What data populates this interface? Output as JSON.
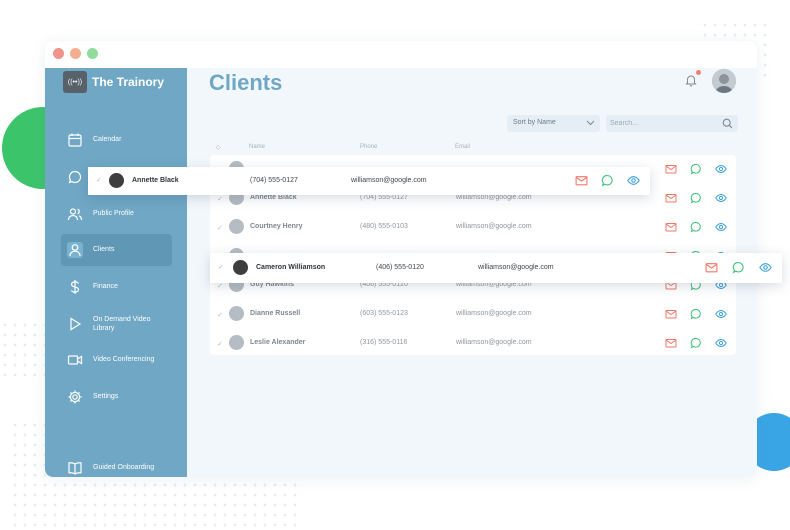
{
  "window": {
    "traffic_lights": [
      "#f0938a",
      "#f5ad92",
      "#8fdc9c"
    ]
  },
  "brand": {
    "logo_text": "((••))",
    "name": "The Trainory"
  },
  "sidebar": {
    "items": [
      {
        "label": "Calendar",
        "icon": "calendar-icon"
      },
      {
        "label": "",
        "icon": "chat-bubble-icon"
      },
      {
        "label": "Public Profile",
        "icon": "users-icon"
      },
      {
        "label": "Clients",
        "icon": "user-icon",
        "active": true
      },
      {
        "label": "Finance",
        "icon": "dollar-icon"
      },
      {
        "label": "On Demand Video Library",
        "icon": "play-icon"
      },
      {
        "label": "Video Conferencing",
        "icon": "video-camera-icon"
      },
      {
        "label": "Settings",
        "icon": "gear-icon"
      },
      {
        "label": "Guided Onboarding",
        "icon": "book-icon"
      }
    ]
  },
  "header": {
    "title": "Clients"
  },
  "toolbar": {
    "sort_label": "Sort by Name",
    "search_placeholder": "Search..."
  },
  "table": {
    "columns": {
      "name": "Name",
      "phone": "Phone",
      "email": "Email"
    },
    "rows": [
      {
        "name": "",
        "phone": "",
        "email": "",
        "partial": true
      },
      {
        "name": "Annette Black",
        "phone": "(704) 555-0127",
        "email": "williamson@google.com"
      },
      {
        "name": "Courtney Henry",
        "phone": "(480) 555-0103",
        "email": "williamson@google.com"
      },
      {
        "name": "",
        "phone": "",
        "email": "",
        "partial": true
      },
      {
        "name": "Guy Hawkins",
        "phone": "(406) 555-0120",
        "email": "williamson@google.com"
      },
      {
        "name": "Dianne Russell",
        "phone": "(603) 555-0123",
        "email": "williamson@google.com"
      },
      {
        "name": "Leslie Alexander",
        "phone": "(316) 555-0116",
        "email": "williamson@google.com"
      }
    ]
  },
  "floating_cards": [
    {
      "name": "Annette Black",
      "phone": "(704) 555-0127",
      "email": "williamson@google.com"
    },
    {
      "name": "Cameron Williamson",
      "phone": "(406) 555-0120",
      "email": "williamson@google.com"
    }
  ],
  "colors": {
    "sidebar": "#6fa7c4",
    "accent_title": "#6fa7c4",
    "mail": "#f07868",
    "chat": "#3bbf7a",
    "view": "#3ca0d8",
    "blob_green": "#3cc46b",
    "blob_blue": "#3aa5e5"
  }
}
